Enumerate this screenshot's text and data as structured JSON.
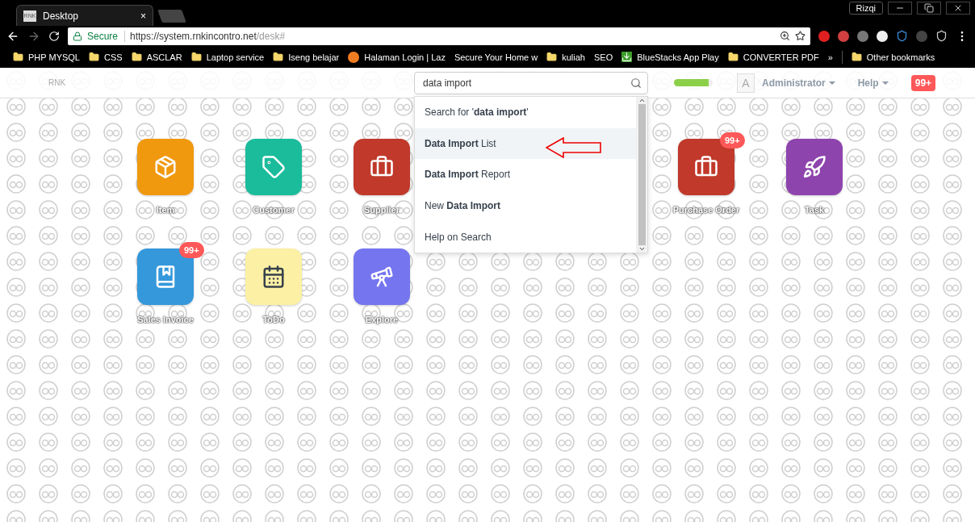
{
  "browser": {
    "tab": {
      "favicon": "RNK",
      "title": "Desktop",
      "close": "×"
    },
    "user": "Rizqi",
    "secure": "Secure",
    "url_host": "https://system.rnkincontro.net",
    "url_path": "/desk#",
    "bookmarks": [
      {
        "kind": "folder",
        "label": "PHP MYSQL"
      },
      {
        "kind": "folder",
        "label": "CSS"
      },
      {
        "kind": "folder",
        "label": "ASCLAR"
      },
      {
        "kind": "folder",
        "label": "Laptop service"
      },
      {
        "kind": "folder",
        "label": "Iseng belajar"
      },
      {
        "kind": "site",
        "label": "Halaman Login | Laz"
      },
      {
        "kind": "none",
        "label": "Secure Your Home w"
      },
      {
        "kind": "folder",
        "label": "kuliah"
      },
      {
        "kind": "none",
        "label": "SEO"
      },
      {
        "kind": "download",
        "label": "BlueStacks App Play"
      },
      {
        "kind": "folder",
        "label": "CONVERTER PDF"
      }
    ],
    "more": "»",
    "other": "Other bookmarks"
  },
  "navbar": {
    "logo": "RNK",
    "search": {
      "value": "data import"
    },
    "progress": {
      "level": 0.9
    },
    "avatar": "A",
    "user": "Administrator",
    "help": "Help",
    "notifications": "99+"
  },
  "search_results": [
    {
      "text": "Search for '**data import**'",
      "selected": false
    },
    {
      "text": "**Data Import** List",
      "selected": true
    },
    {
      "text": "**Data Import** Report",
      "selected": false
    },
    {
      "text": "New **Data Import**",
      "selected": false
    },
    {
      "text": "Help on Search",
      "selected": false
    }
  ],
  "apps": [
    {
      "label": "Item",
      "color": "#f0990f"
    },
    {
      "label": "Customer",
      "color": "#1abc9c"
    },
    {
      "label": "Supplier",
      "color": "#c0392b"
    },
    {
      "label": "Purchase Order",
      "color": "#c0392b",
      "badge": "99+"
    },
    {
      "label": "Task",
      "color": "#8e44ad"
    },
    {
      "label": "Sales Invoice",
      "color": "#3498db",
      "badge": "99+"
    },
    {
      "label": "ToDo",
      "color": "#fcf0a4"
    },
    {
      "label": "Explore",
      "color": "#7575f0"
    }
  ]
}
